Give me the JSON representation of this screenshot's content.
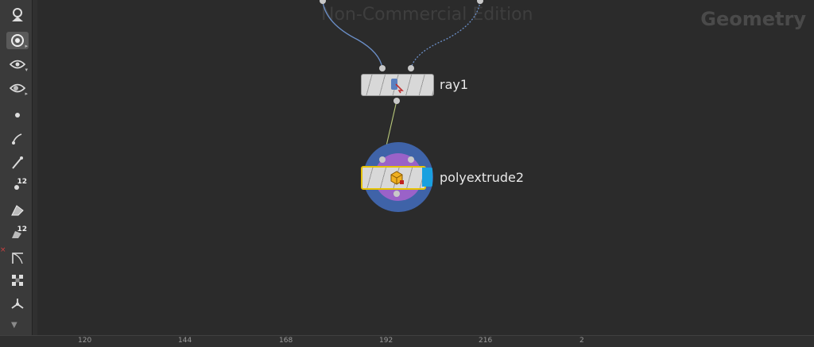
{
  "watermark": "Non-Commercial Edition",
  "context_label": "Geometry",
  "nodes": {
    "ray": {
      "label": "ray1",
      "icon": "ray-node-icon"
    },
    "polyextrude": {
      "label": "polyextrude2",
      "icon": "polyextrude-node-icon",
      "selected": true,
      "display_flag": true
    }
  },
  "toolbar": {
    "tools": [
      {
        "name": "select-tool-icon"
      },
      {
        "name": "view-tool-icon",
        "active": true
      },
      {
        "name": "visibility-tool-icon"
      },
      {
        "name": "display-options-icon"
      },
      {
        "name": "points-icon"
      },
      {
        "name": "pin-tool-icon"
      },
      {
        "name": "brush-tool-icon"
      },
      {
        "name": "point-numbers-icon",
        "num": "12"
      },
      {
        "name": "primitive-display-icon"
      },
      {
        "name": "primitive-numbers-icon",
        "num": "12"
      },
      {
        "name": "frame-icon"
      },
      {
        "name": "checker-icon"
      },
      {
        "name": "transform-handle-icon"
      }
    ]
  },
  "ruler": {
    "ticks": [
      "120",
      "144",
      "168",
      "192",
      "216",
      "2"
    ]
  },
  "colors": {
    "background": "#2b2b2b",
    "selection_outer": "#3f63a8",
    "selection_inner": "#9a62c8",
    "display_flag": "#19a0e0",
    "node_selected_border": "#e6c200"
  }
}
